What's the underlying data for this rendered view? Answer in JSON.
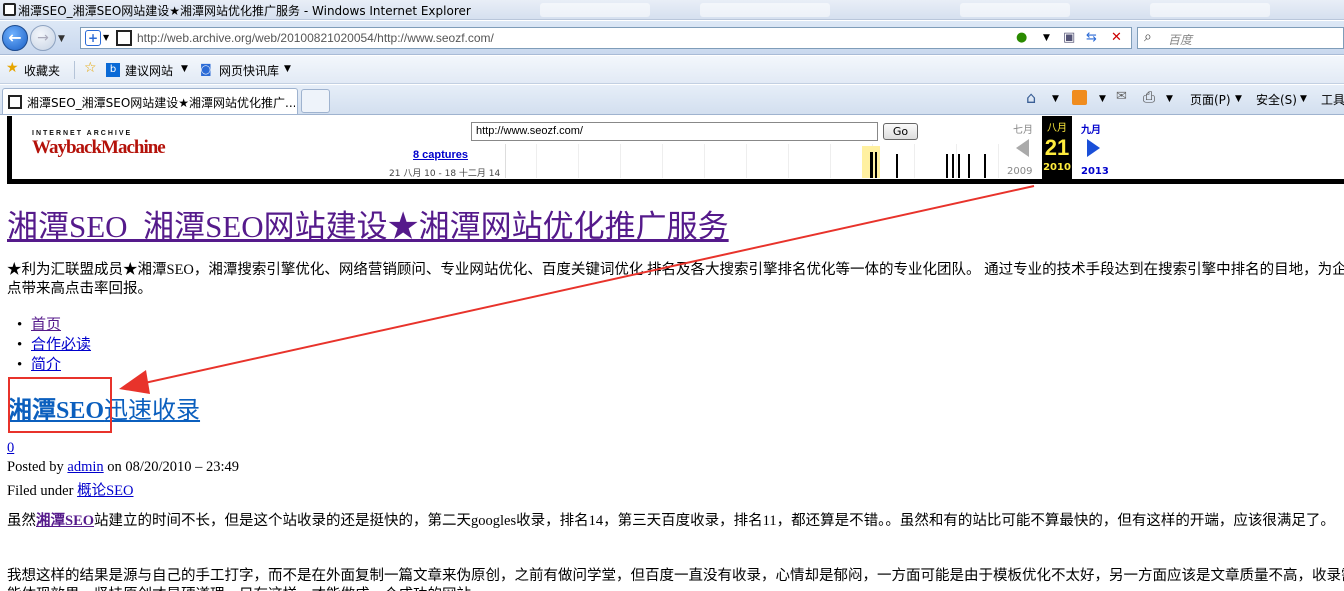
{
  "window": {
    "title": "湘潭SEO_湘潭SEO网站建设★湘潭网站优化推广服务 - Windows Internet Explorer"
  },
  "address_bar": {
    "url": "http://web.archive.org/web/20100821020054/http://www.seozf.com/",
    "search_placeholder": "百度"
  },
  "favorites_bar": {
    "favorites_label": "收藏夹",
    "suggested_sites": "建议网站",
    "web_slice_gallery": "网页快讯库"
  },
  "tabs": [
    {
      "title": "湘潭SEO_湘潭SEO网站建设★湘潭网站优化推广..."
    }
  ],
  "command_bar": {
    "page": "页面(P)",
    "safety": "安全(S)",
    "tools": "工具"
  },
  "wayback": {
    "logo_top": "INTERNET ARCHIVE",
    "logo_bottom": "WaybackMachine",
    "url_value": "http://www.seozf.com/",
    "go_label": "Go",
    "captures": "8 captures",
    "range": "21 八月 10 - 18 十二月 14",
    "prev_month": "七月",
    "cur_month": "八月",
    "next_month": "九月",
    "cur_day": "21",
    "prev_year": "2009",
    "cur_year": "2010",
    "next_year": "2013"
  },
  "page": {
    "site_title": "湘潭SEO_湘潭SEO网站建设★湘潭网站优化推广服务",
    "site_description": "★利为汇联盟成员★湘潭SEO，湘潭搜索引擎优化、网络营销顾问、专业网站优化、百度关键词优化 排名及各大搜索引擎排名优化等一体的专业化团队。 通过专业的技术手段达到在搜索引擎中排名的目地，为企业及个人站点带来高点击率回报。",
    "menu": [
      "首页",
      "合作必读",
      "简介"
    ],
    "post": {
      "title_bold": "湘潭SEO",
      "title_rest": "迅速收录",
      "comments": "0",
      "posted_by_label": "Posted by",
      "author": "admin",
      "date": "on 08/20/2010 – 23:49",
      "filed_label": "Filed under",
      "category": "概论SEO",
      "para1_prefix": "虽然",
      "para1_link": "湘潭SEO",
      "para1_text": "站建立的时间不长，但是这个站收录的还是挺快的，第二天googles收录，排名14，第三天百度收录，排名11，都还算是不错。。虽然和有的站比可能不算最快的，但有这样的开端，应该很满足了。",
      "para2_text": "我想这样的结果是源与自己的手工打字，而不是在外面复制一篇文章来伪原创，之前有做问学堂，但百度一直没有收录，心情却是郁闷，一方面可能是由于模板优化不太好，另一方面应该是文章质量不高，收录需要时间才能体现效果，坚持原创才是硬道理，只有这样，才能做成一个成功的网站。"
    }
  },
  "annotation": {
    "color": "#e8332b"
  }
}
